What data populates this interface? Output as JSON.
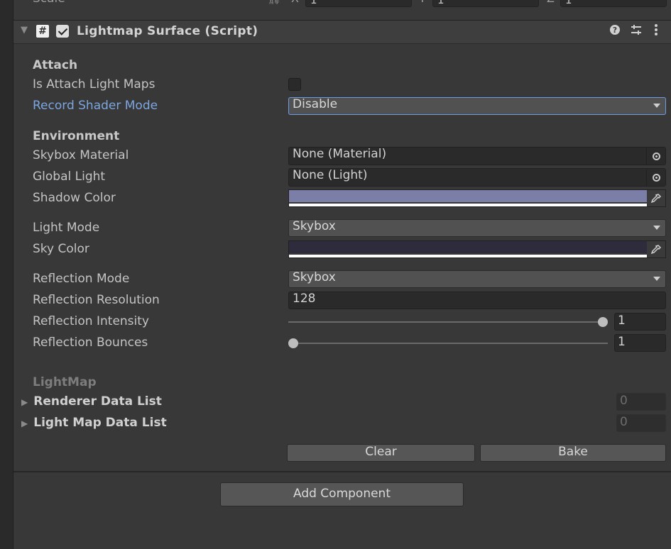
{
  "transform": {
    "scale_label": "Scale",
    "x_axis": "X",
    "y_axis": "Y",
    "z_axis": "Z",
    "x_value": "1",
    "y_value": "1",
    "z_value": "1"
  },
  "component": {
    "title": "Lightmap Surface (Script)",
    "script_badge": "#",
    "enabled": true
  },
  "attach": {
    "section": "Attach",
    "is_attach_label": "Is Attach Light Maps",
    "is_attach_value": false,
    "record_shader_label": "Record Shader Mode",
    "record_shader_value": "Disable"
  },
  "environment": {
    "section": "Environment",
    "skybox_label": "Skybox Material",
    "skybox_value": "None (Material)",
    "global_light_label": "Global Light",
    "global_light_value": "None (Light)",
    "shadow_color_label": "Shadow Color",
    "shadow_color": "#7b7fa8",
    "light_mode_label": "Light Mode",
    "light_mode_value": "Skybox",
    "sky_color_label": "Sky Color",
    "sky_color": "#2e2b3c",
    "reflection_mode_label": "Reflection Mode",
    "reflection_mode_value": "Skybox",
    "reflection_resolution_label": "Reflection Resolution",
    "reflection_resolution_value": "128",
    "reflection_intensity_label": "Reflection Intensity",
    "reflection_intensity_value": "1",
    "reflection_bounces_label": "Reflection Bounces",
    "reflection_bounces_value": "1"
  },
  "lightmap": {
    "section": "LightMap",
    "renderer_list_label": "Renderer Data List",
    "renderer_list_count": "0",
    "lightmap_list_label": "Light Map Data List",
    "lightmap_list_count": "0"
  },
  "actions": {
    "clear_label": "Clear",
    "bake_label": "Bake",
    "add_component_label": "Add Component"
  },
  "icons": [
    "fold-icon",
    "script-icon",
    "enable-checkbox",
    "help-icon",
    "presets-icon",
    "more-icon",
    "object-picker-icon",
    "eyedropper-icon",
    "dropdown-arrow-icon",
    "foldout-arrow-icon"
  ]
}
